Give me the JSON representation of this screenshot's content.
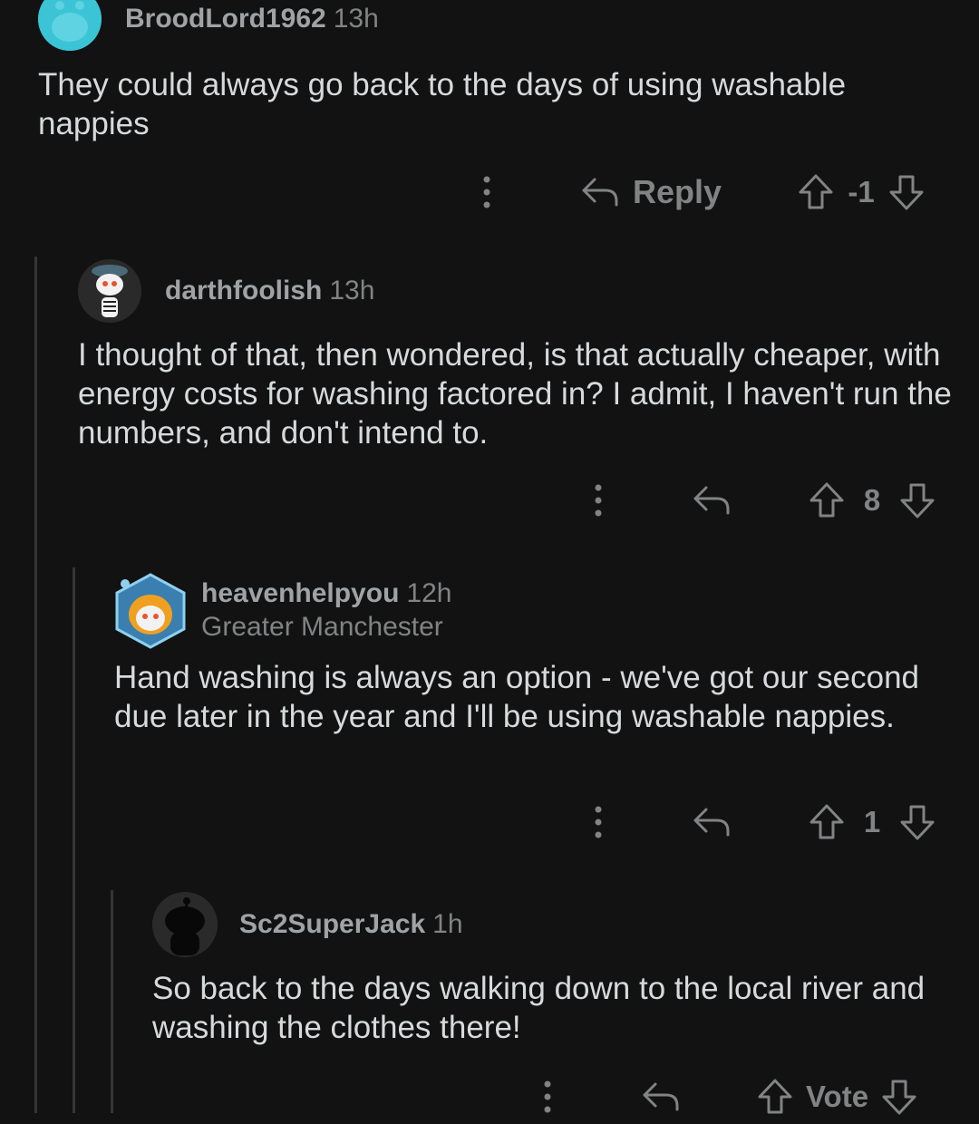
{
  "comments": [
    {
      "username": "BroodLord1962",
      "age": "13h",
      "flair": "",
      "body": "They could always go back to the days of using washable nappies",
      "reply_label": "Reply",
      "score": "-1",
      "avatar_color": "#3bc4d6"
    },
    {
      "username": "darthfoolish",
      "age": "13h",
      "flair": "",
      "body": "I thought of that, then wondered, is that actually cheaper, with energy costs for washing factored in? I admit, I haven't run the numbers, and don't intend to.",
      "reply_label": "",
      "score": "8",
      "avatar_color": "#2a2a2a"
    },
    {
      "username": "heavenhelpyou",
      "age": "12h",
      "flair": "Greater Manchester",
      "body": "Hand washing is always an option - we've got our second due later in the year and I'll be using washable nappies.",
      "reply_label": "",
      "score": "1",
      "avatar_color": "#2b6f9c"
    },
    {
      "username": "Sc2SuperJack",
      "age": "1h",
      "flair": "",
      "body": "So back to the days walking down to the local river and washing the clothes there!",
      "reply_label": "",
      "score": "Vote",
      "avatar_color": "#2a2a2a"
    }
  ],
  "icons": {
    "more": "more-vertical-icon",
    "reply": "reply-arrow-icon",
    "upvote": "upvote-arrow-icon",
    "downvote": "downvote-arrow-icon"
  },
  "colors": {
    "background": "#121212",
    "text": "#d7dadc",
    "muted": "#818384",
    "thread_line": "#343536"
  }
}
